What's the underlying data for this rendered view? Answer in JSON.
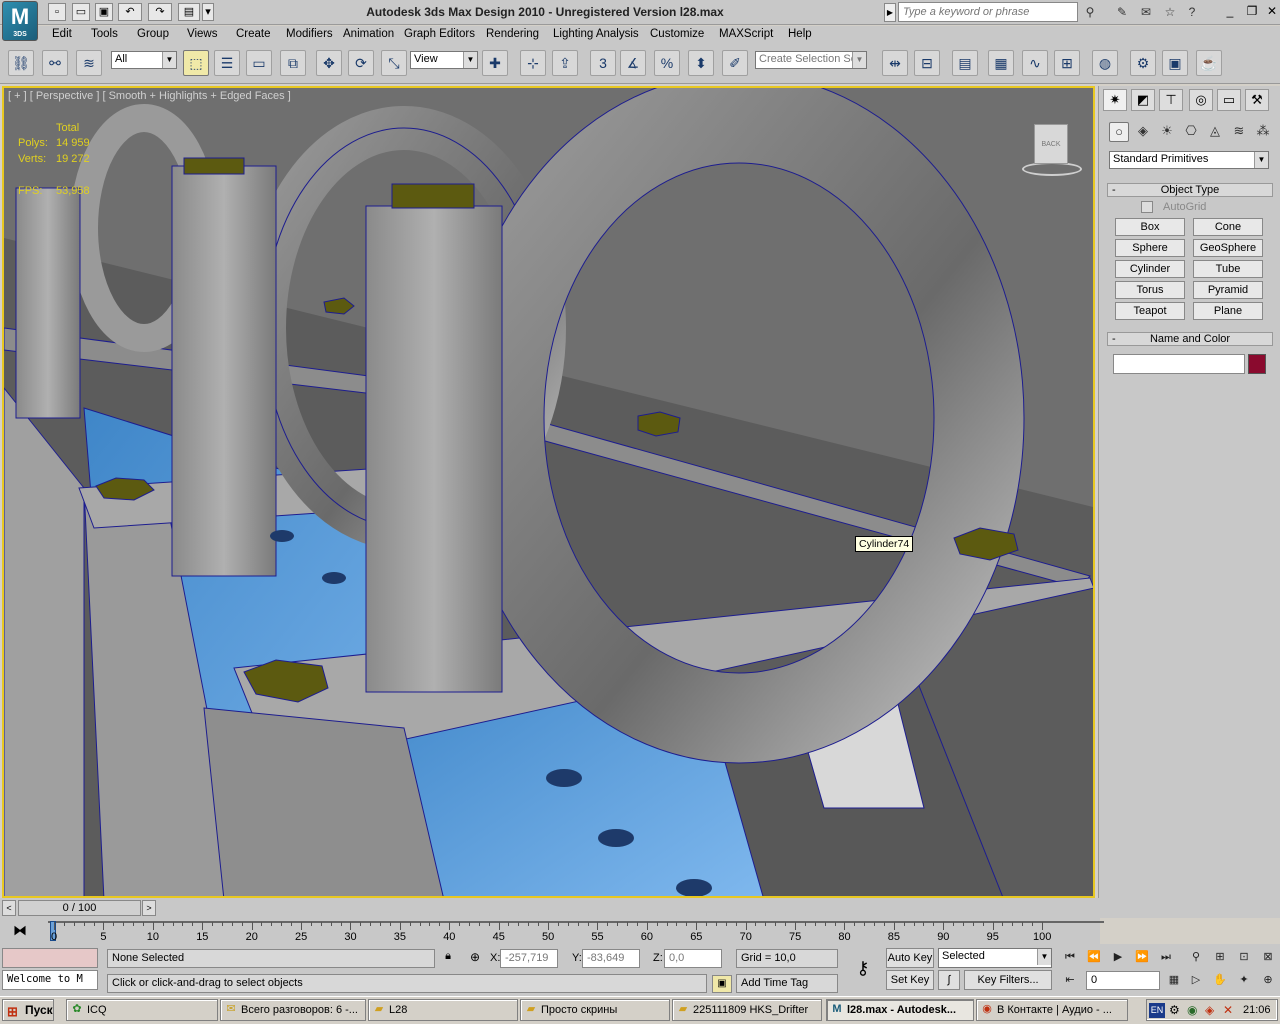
{
  "titlebar": {
    "logo_text": "M",
    "logo_sub": "3DS",
    "title": "Autodesk 3ds Max Design 2010    -    Unregistered Version      l28.max",
    "search_placeholder": "Type a keyword or phrase",
    "quick_icons": [
      "new-icon",
      "open-icon",
      "save-icon",
      "undo-icon",
      "redo-icon",
      "project-folder-icon",
      "dropdown-icon"
    ]
  },
  "menubar": {
    "items": [
      "Edit",
      "Tools",
      "Group",
      "Views",
      "Create",
      "Modifiers",
      "Animation",
      "Graph Editors",
      "Rendering",
      "Lighting Analysis",
      "Customize",
      "MAXScript",
      "Help"
    ]
  },
  "toolbar": {
    "selection_filter": "All",
    "reference_coord": "View",
    "named_selection_placeholder": "Create Selection Se",
    "snap_label": "3"
  },
  "viewport": {
    "label": "[ + ] [ Perspective ] [ Smooth + Highlights + Edged Faces ]",
    "stats": {
      "total_label": "Total",
      "polys_label": "Polys:",
      "polys_value": "14 959",
      "verts_label": "Verts:",
      "verts_value": "19 272",
      "fps_label": "FPS:",
      "fps_value": "53,958"
    },
    "viewcube_face": "BACK",
    "tooltip": "Cylinder74"
  },
  "command_panel": {
    "category": "Standard Primitives",
    "object_type_title": "Object Type",
    "autogrid_label": "AutoGrid",
    "buttons": [
      "Box",
      "Cone",
      "Sphere",
      "GeoSphere",
      "Cylinder",
      "Tube",
      "Torus",
      "Pyramid",
      "Teapot",
      "Plane"
    ],
    "name_color_title": "Name and Color",
    "name_value": "",
    "color_swatch": "#8a0a2e"
  },
  "timeline": {
    "slider_label": "0 / 100",
    "ticks": [
      "0",
      "5",
      "10",
      "15",
      "20",
      "25",
      "30",
      "35",
      "40",
      "45",
      "50",
      "55",
      "60",
      "65",
      "70",
      "75",
      "80",
      "85",
      "90",
      "95",
      "100"
    ]
  },
  "status": {
    "selection": "None Selected",
    "prompt": "Click or click-and-drag to select objects",
    "maxscript_listener": "Welcome to M",
    "x_label": "X:",
    "x_value": "-257,719",
    "y_label": "Y:",
    "y_value": "-83,649",
    "z_label": "Z:",
    "z_value": "0,0",
    "grid": "Grid = 10,0",
    "add_time_tag": "Add Time Tag",
    "auto_key": "Auto Key",
    "set_key": "Set Key",
    "key_mode": "Selected",
    "key_filters": "Key Filters...",
    "frame_value": "0"
  },
  "taskbar": {
    "start_label": "Пуск",
    "tasks": [
      {
        "label": "ICQ",
        "icon": "icq-flower-icon"
      },
      {
        "label": "Всего разговоров: 6 -...",
        "icon": "chat-icon"
      },
      {
        "label": "L28",
        "icon": "folder-icon"
      },
      {
        "label": "Просто скрины",
        "icon": "folder-icon"
      },
      {
        "label": "225111809 HKS_Drifter",
        "icon": "folder-icon"
      },
      {
        "label": "l28.max - Autodesk...",
        "icon": "3dsmax-icon"
      },
      {
        "label": "В Контакте | Аудио - ...",
        "icon": "browser-icon"
      }
    ],
    "lang": "EN",
    "clock": "21:06"
  }
}
